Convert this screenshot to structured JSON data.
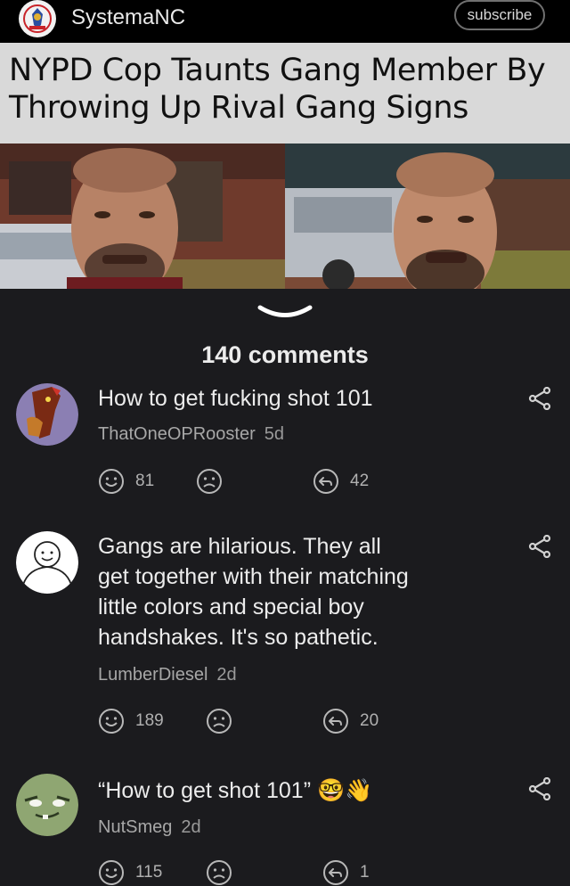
{
  "header": {
    "channel_name": "SystemaNC",
    "subscribe_label": "subscribe"
  },
  "post": {
    "headline": "NYPD Cop Taunts Gang Member By\nThrowing Up Rival Gang Signs"
  },
  "comments_header": {
    "count_label": "140 comments"
  },
  "comments": [
    {
      "text": "How to get fucking shot 101",
      "author": "ThatOneOPRooster",
      "age": "5d",
      "upvotes": "81",
      "replies": "42",
      "avatar_icon": "rooster-avatar-icon"
    },
    {
      "text": "Gangs are hilarious. They all\nget together with their matching\nlittle colors and special boy\nhandshakes. It's so pathetic.",
      "author": "LumberDiesel",
      "age": "2d",
      "upvotes": "189",
      "replies": "20",
      "avatar_icon": "smiley-avatar-icon"
    },
    {
      "text": "“How to get shot 101” 🤓👋",
      "author": "NutSmeg",
      "age": "2d",
      "upvotes": "115",
      "replies": "1",
      "avatar_icon": "green-face-avatar-icon"
    }
  ],
  "colors": {
    "background": "#1b1b1e",
    "topbar": "#000000",
    "headline_bg": "#d9d9d9",
    "text_primary": "#ececec",
    "text_secondary": "#a7a7a7"
  }
}
